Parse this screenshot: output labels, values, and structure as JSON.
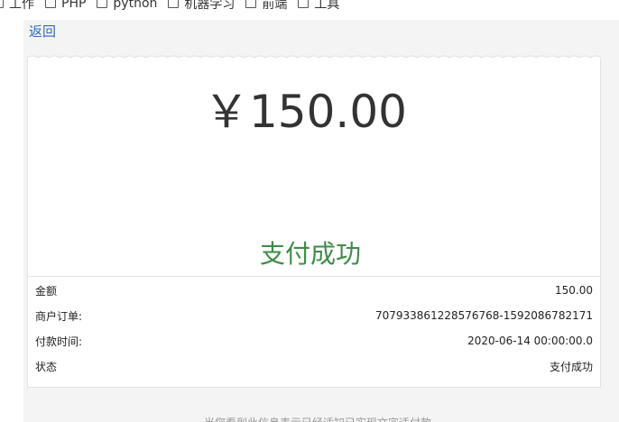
{
  "bookmarks": [
    {
      "label": "工作"
    },
    {
      "label": "PHP"
    },
    {
      "label": "python"
    },
    {
      "label": "机器学习"
    },
    {
      "label": "前端"
    },
    {
      "label": "工具"
    }
  ],
  "back_label": "返回",
  "payment": {
    "amount_display": "￥150.00",
    "status_text": "支付成功"
  },
  "details": [
    {
      "label": "金额",
      "value": "150.00"
    },
    {
      "label": "商户订单:",
      "value": "707933861228576768-1592086782171"
    },
    {
      "label": "付款时间:",
      "value": "2020-06-14 00:00:00.0"
    },
    {
      "label": "状态",
      "value": "支付成功"
    }
  ],
  "footer_note": "当您看到此信息表示已经适知已实现文字适付款",
  "colors": {
    "link": "#2e6db5",
    "success": "#3f8b4a",
    "background": "#f4f4f4"
  }
}
